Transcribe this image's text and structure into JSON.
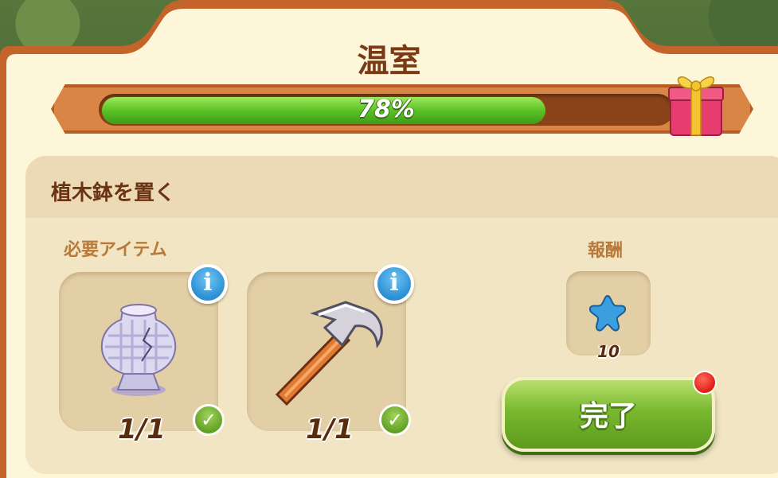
{
  "title": "温室",
  "progress": {
    "value": 0.78,
    "label": "78%"
  },
  "task": {
    "title": "植木鉢を置く",
    "required_label": "必要アイテム",
    "reward_label": "報酬",
    "items": [
      {
        "icon": "cracked-vase-icon",
        "count": "1/1",
        "complete": true
      },
      {
        "icon": "hammer-icon",
        "count": "1/1",
        "complete": true
      }
    ],
    "reward": {
      "icon": "blue-star-icon",
      "count": "10"
    }
  },
  "complete_button": {
    "label": "完了",
    "has_notification": true
  },
  "colors": {
    "frame": "#c5642a",
    "panel": "#fdf6d8",
    "progress_fill": "#5bc224",
    "info": "#2b8fd4",
    "button": "#79b82e",
    "notification": "#e01e14"
  }
}
